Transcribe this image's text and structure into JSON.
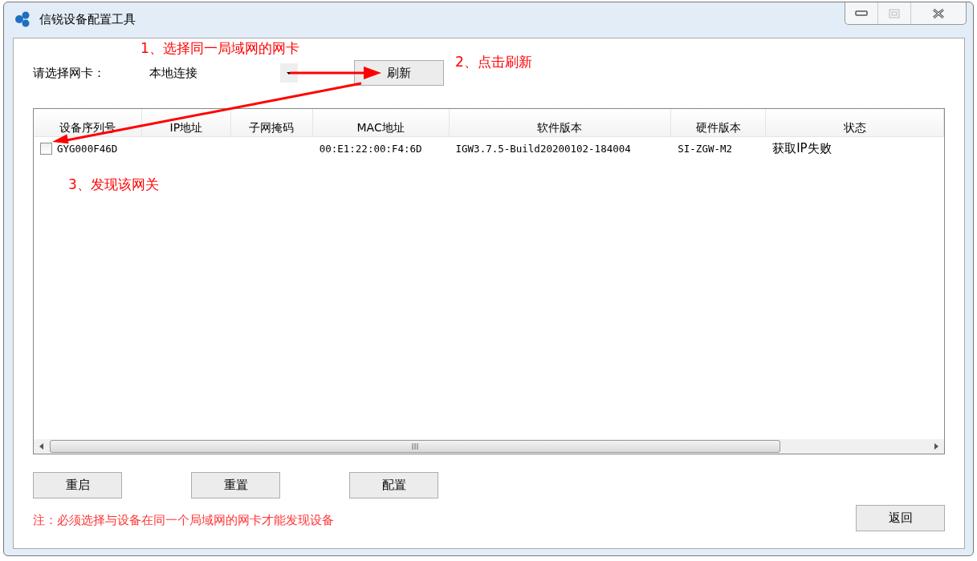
{
  "window": {
    "title": "信锐设备配置工具"
  },
  "nic_picker": {
    "label": "请选择网卡：",
    "value": "本地连接",
    "refresh_button": "刷新"
  },
  "table": {
    "columns": [
      "设备序列号",
      "IP地址",
      "子网掩码",
      "MAC地址",
      "软件版本",
      "硬件版本",
      "状态"
    ],
    "rows": [
      {
        "checked": false,
        "cells": [
          "GYG000F46D",
          "",
          "",
          "00:E1:22:00:F4:6D",
          "IGW3.7.5-Build20200102-184004",
          "SI-ZGW-M2",
          "获取IP失败"
        ]
      }
    ]
  },
  "actions": [
    "重启",
    "重置",
    "配置"
  ],
  "note": "注：必须选择与设备在同一个局域网的网卡才能发现设备",
  "back_button": "返回",
  "annotations": [
    "1、选择同一局域网的网卡",
    "2、点击刷新",
    "3、发现该网关"
  ]
}
